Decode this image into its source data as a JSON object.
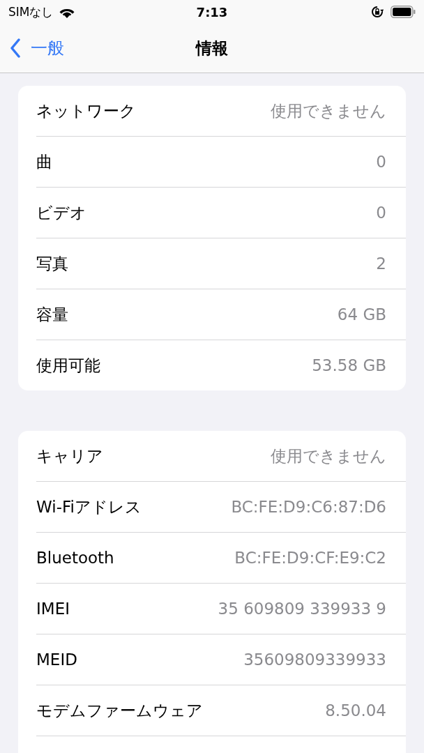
{
  "status_bar": {
    "carrier": "SIMなし",
    "time": "7:13"
  },
  "nav": {
    "back": "一般",
    "title": "情報"
  },
  "groups": [
    {
      "rows": [
        {
          "label": "ネットワーク",
          "value": "使用できません"
        },
        {
          "label": "曲",
          "value": "0"
        },
        {
          "label": "ビデオ",
          "value": "0"
        },
        {
          "label": "写真",
          "value": "2"
        },
        {
          "label": "容量",
          "value": "64 GB"
        },
        {
          "label": "使用可能",
          "value": "53.58 GB"
        }
      ]
    },
    {
      "rows": [
        {
          "label": "キャリア",
          "value": "使用できません"
        },
        {
          "label": "Wi-Fiアドレス",
          "value": "BC:FE:D9:C6:87:D6"
        },
        {
          "label": "Bluetooth",
          "value": "BC:FE:D9:CF:E9:C2"
        },
        {
          "label": "IMEI",
          "value": "35 609809 339933 9"
        },
        {
          "label": "MEID",
          "value": "35609809339933"
        },
        {
          "label": "モデムファームウェア",
          "value": "8.50.04"
        }
      ]
    }
  ]
}
